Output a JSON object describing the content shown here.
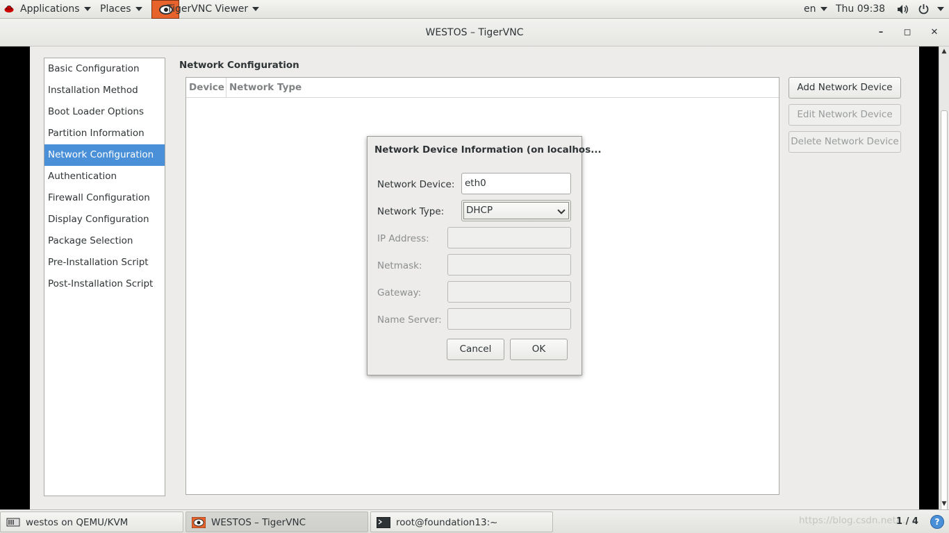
{
  "top_panel": {
    "applications": "Applications",
    "places": "Places",
    "active_app": "TigerVNC Viewer",
    "language": "en",
    "clock": "Thu 09:38"
  },
  "window": {
    "title": "WESTOS – TigerVNC",
    "minimize": "–",
    "maximize": "◻",
    "close": "✕"
  },
  "sidebar": {
    "items": [
      {
        "label": "Basic Configuration"
      },
      {
        "label": "Installation Method"
      },
      {
        "label": "Boot Loader Options"
      },
      {
        "label": "Partition Information"
      },
      {
        "label": "Network Configuration"
      },
      {
        "label": "Authentication"
      },
      {
        "label": "Firewall Configuration"
      },
      {
        "label": "Display Configuration"
      },
      {
        "label": "Package Selection"
      },
      {
        "label": "Pre-Installation Script"
      },
      {
        "label": "Post-Installation Script"
      }
    ],
    "selected_index": 4
  },
  "main": {
    "title": "Network Configuration",
    "table": {
      "columns": [
        "Device",
        "Network Type"
      ],
      "rows": []
    },
    "buttons": {
      "add": "Add Network Device",
      "edit": "Edit Network Device",
      "delete": "Delete Network Device"
    }
  },
  "dialog": {
    "title": "Network Device Information (on localhos...",
    "device_label": "Network Device:",
    "device_value": "eth0",
    "type_label": "Network Type:",
    "type_value": "DHCP",
    "ip_label": "IP Address:",
    "netmask_label": "Netmask:",
    "gateway_label": "Gateway:",
    "nameserver_label": "Name Server:",
    "cancel": "Cancel",
    "ok": "OK"
  },
  "taskbar": {
    "tasks": [
      {
        "label": "westos on QEMU/KVM"
      },
      {
        "label": "WESTOS – TigerVNC"
      },
      {
        "label": "root@foundation13:~"
      }
    ],
    "watermark": "https://blog.csdn.net/...",
    "pager": "1 / 4",
    "help": "?"
  }
}
